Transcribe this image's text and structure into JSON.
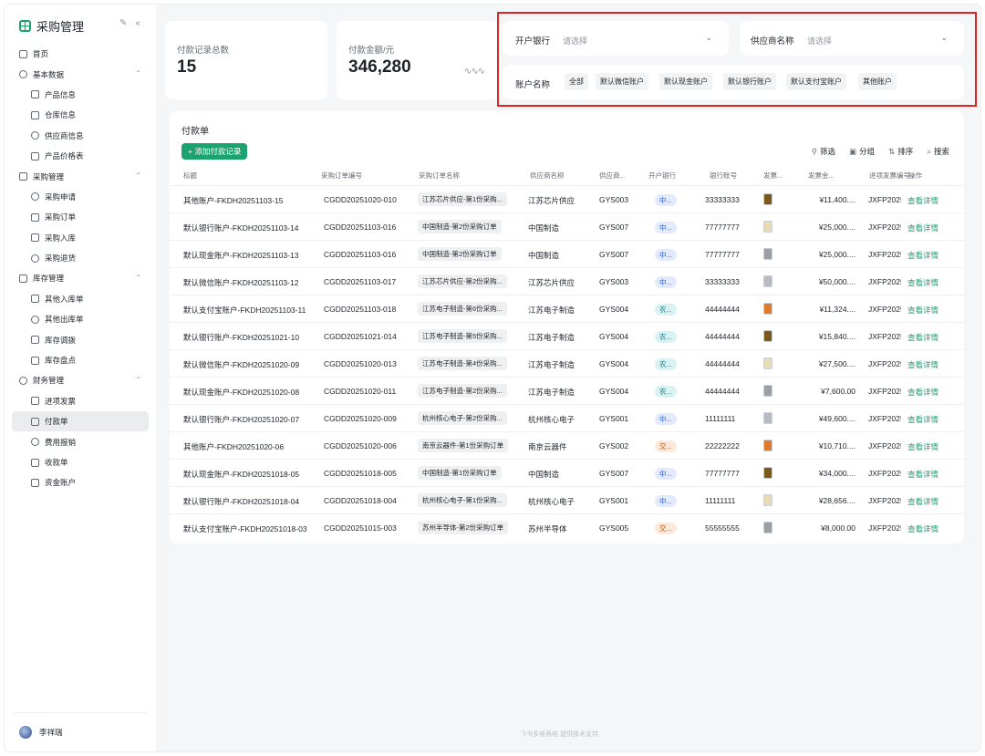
{
  "app": {
    "title": "采购管理"
  },
  "sidebar": {
    "items": [
      {
        "label": "首页",
        "level": 0,
        "icon": "home-icon"
      },
      {
        "label": "基本数据",
        "level": 0,
        "icon": "layers-icon",
        "expandable": true
      },
      {
        "label": "产品信息",
        "level": 1,
        "icon": "globe-icon"
      },
      {
        "label": "仓库信息",
        "level": 1,
        "icon": "warehouse-icon"
      },
      {
        "label": "供应商信息",
        "level": 1,
        "icon": "monitor-icon"
      },
      {
        "label": "产品价格表",
        "level": 1,
        "icon": "price-icon"
      },
      {
        "label": "采购管理",
        "level": 0,
        "icon": "list-icon",
        "expandable": true
      },
      {
        "label": "采购申请",
        "level": 1,
        "icon": "mail-icon"
      },
      {
        "label": "采购订单",
        "level": 1,
        "icon": "calendar-icon"
      },
      {
        "label": "采购入库",
        "level": 1,
        "icon": "inbox-icon"
      },
      {
        "label": "采购退货",
        "level": 1,
        "icon": "return-icon"
      },
      {
        "label": "库存管理",
        "level": 0,
        "icon": "clock-icon",
        "expandable": true
      },
      {
        "label": "其他入库单",
        "level": 1,
        "icon": "image-icon"
      },
      {
        "label": "其他出库单",
        "level": 1,
        "icon": "bulb-icon"
      },
      {
        "label": "库存调拨",
        "level": 1,
        "icon": "transfer-icon"
      },
      {
        "label": "库存盘点",
        "level": 1,
        "icon": "settings-icon"
      },
      {
        "label": "财务管理",
        "level": 0,
        "icon": "copy-icon",
        "expandable": true
      },
      {
        "label": "进项发票",
        "level": 1,
        "icon": "barcode-icon"
      },
      {
        "label": "付款单",
        "level": 1,
        "icon": "chart-icon",
        "active": true
      },
      {
        "label": "费用报销",
        "level": 1,
        "icon": "pin-icon"
      },
      {
        "label": "收款单",
        "level": 1,
        "icon": "location-icon"
      },
      {
        "label": "资金账户",
        "level": 1,
        "icon": "bar-icon"
      }
    ],
    "user": "李祥瑞"
  },
  "stats": {
    "count_label": "付款记录总数",
    "count_value": "15",
    "amount_label": "付款金额/元",
    "amount_value": "346,280"
  },
  "filters": {
    "bank_label": "开户银行",
    "bank_placeholder": "请选择",
    "supplier_label": "供应商名称",
    "supplier_placeholder": "请选择",
    "account_label": "账户名称",
    "account_tags": [
      "全部",
      "默认微信账户",
      "默认现金账户",
      "默认银行账户",
      "默认支付宝账户",
      "其他账户"
    ]
  },
  "table": {
    "title": "付款单",
    "add_button": "+ 添加付款记录",
    "toolbar": {
      "filter": "筛选",
      "group": "分组",
      "sort": "排序",
      "search": "搜索"
    },
    "headers": [
      "标题",
      "采购订单编号",
      "采购订单名称",
      "供应商名称",
      "供应商...",
      "开户银行",
      "银行账号",
      "发票...",
      "发票金...",
      "进项发票编号",
      "操作"
    ],
    "rows": [
      {
        "title": "其他账户-FKDH20251103-15",
        "order_no": "CGDD20251020-010",
        "order_name": "江苏芯片供应-第1份采购...",
        "supplier": "江苏芯片供应",
        "supplier_code": "GYS003",
        "bank": "中...",
        "bank_color": "blue",
        "account": "33333333",
        "thumb": "#7a5a1a",
        "amount": "¥11,400....",
        "invoice": "JXFP2025",
        "action": "查看详情"
      },
      {
        "title": "默认银行账户-FKDH20251103-14",
        "order_no": "CGDD20251103-016",
        "order_name": "中国制造-第2份采购订单",
        "supplier": "中国制造",
        "supplier_code": "GYS007",
        "bank": "中...",
        "bank_color": "blue",
        "account": "77777777",
        "thumb": "#e8dcb8",
        "amount": "¥25,000....",
        "invoice": "JXFP2025",
        "action": "查看详情"
      },
      {
        "title": "默认现金账户-FKDH20251103-13",
        "order_no": "CGDD20251103-016",
        "order_name": "中国制造-第2份采购订单",
        "supplier": "中国制造",
        "supplier_code": "GYS007",
        "bank": "中...",
        "bank_color": "blue",
        "account": "77777777",
        "thumb": "#9aa0a6",
        "amount": "¥25,000....",
        "invoice": "JXFP2025",
        "action": "查看详情"
      },
      {
        "title": "默认微信账户-FKDH20251103-12",
        "order_no": "CGDD20251103-017",
        "order_name": "江苏芯片供应-第2份采购...",
        "supplier": "江苏芯片供应",
        "supplier_code": "GYS003",
        "bank": "中...",
        "bank_color": "blue",
        "account": "33333333",
        "thumb": "#b8bcc2",
        "amount": "¥50,000....",
        "invoice": "JXFP2025",
        "action": "查看详情"
      },
      {
        "title": "默认支付宝账户-FKDH20251103-11",
        "order_no": "CGDD20251103-018",
        "order_name": "江苏电子制造-第6份采购...",
        "supplier": "江苏电子制造",
        "supplier_code": "GYS004",
        "bank": "农...",
        "bank_color": "teal",
        "account": "44444444",
        "thumb": "#e07a2c",
        "amount": "¥11,324....",
        "invoice": "JXFP2025",
        "action": "查看详情"
      },
      {
        "title": "默认银行账户-FKDH20251021-10",
        "order_no": "CGDD20251021-014",
        "order_name": "江苏电子制造-第5份采购...",
        "supplier": "江苏电子制造",
        "supplier_code": "GYS004",
        "bank": "农...",
        "bank_color": "teal",
        "account": "44444444",
        "thumb": "#7a5a1a",
        "amount": "¥15,840....",
        "invoice": "JXFP2025",
        "action": "查看详情"
      },
      {
        "title": "默认微信账户-FKDH20251020-09",
        "order_no": "CGDD20251020-013",
        "order_name": "江苏电子制造-第4份采购...",
        "supplier": "江苏电子制造",
        "supplier_code": "GYS004",
        "bank": "农...",
        "bank_color": "teal",
        "account": "44444444",
        "thumb": "#e8dcb8",
        "amount": "¥27,500....",
        "invoice": "JXFP2025",
        "action": "查看详情"
      },
      {
        "title": "默认现金账户-FKDH20251020-08",
        "order_no": "CGDD20251020-011",
        "order_name": "江苏电子制造-第2份采购...",
        "supplier": "江苏电子制造",
        "supplier_code": "GYS004",
        "bank": "农...",
        "bank_color": "teal",
        "account": "44444444",
        "thumb": "#9aa0a6",
        "amount": "¥7,600.00",
        "invoice": "JXFP2025",
        "action": "查看详情"
      },
      {
        "title": "默认银行账户-FKDH20251020-07",
        "order_no": "CGDD20251020-009",
        "order_name": "杭州核心电子-第2份采购...",
        "supplier": "杭州核心电子",
        "supplier_code": "GYS001",
        "bank": "中...",
        "bank_color": "blue",
        "account": "11111111",
        "thumb": "#b8bcc2",
        "amount": "¥49,600....",
        "invoice": "JXFP2025",
        "action": "查看详情"
      },
      {
        "title": "其他账户-FKDH20251020-06",
        "order_no": "CGDD20251020-006",
        "order_name": "南京云器件-第1份采购订单",
        "supplier": "南京云器件",
        "supplier_code": "GYS002",
        "bank": "交...",
        "bank_color": "orange",
        "account": "22222222",
        "thumb": "#e07a2c",
        "amount": "¥10,710....",
        "invoice": "JXFP2025",
        "action": "查看详情"
      },
      {
        "title": "默认现金账户-FKDH20251018-05",
        "order_no": "CGDD20251018-005",
        "order_name": "中国制造-第1份采购订单",
        "supplier": "中国制造",
        "supplier_code": "GYS007",
        "bank": "中...",
        "bank_color": "blue",
        "account": "77777777",
        "thumb": "#7a5a1a",
        "amount": "¥34,000....",
        "invoice": "JXFP2025",
        "action": "查看详情"
      },
      {
        "title": "默认银行账户-FKDH20251018-04",
        "order_no": "CGDD20251018-004",
        "order_name": "杭州核心电子-第1份采购...",
        "supplier": "杭州核心电子",
        "supplier_code": "GYS001",
        "bank": "中...",
        "bank_color": "blue",
        "account": "11111111",
        "thumb": "#e8dcb8",
        "amount": "¥28,656....",
        "invoice": "JXFP2025",
        "action": "查看详情"
      },
      {
        "title": "默认支付宝账户-FKDH20251018-03",
        "order_no": "CGDD20251015-003",
        "order_name": "苏州半导体-第2份采购订单",
        "supplier": "苏州半导体",
        "supplier_code": "GYS005",
        "bank": "交...",
        "bank_color": "orange",
        "account": "55555555",
        "thumb": "#9aa0a6",
        "amount": "¥8,000.00",
        "invoice": "JXFP2025",
        "action": "查看详情"
      }
    ]
  },
  "footer": "飞书多维表格 提供技术支持",
  "colors": {
    "accent": "#1aa36f",
    "highlight_border": "#e02424"
  }
}
